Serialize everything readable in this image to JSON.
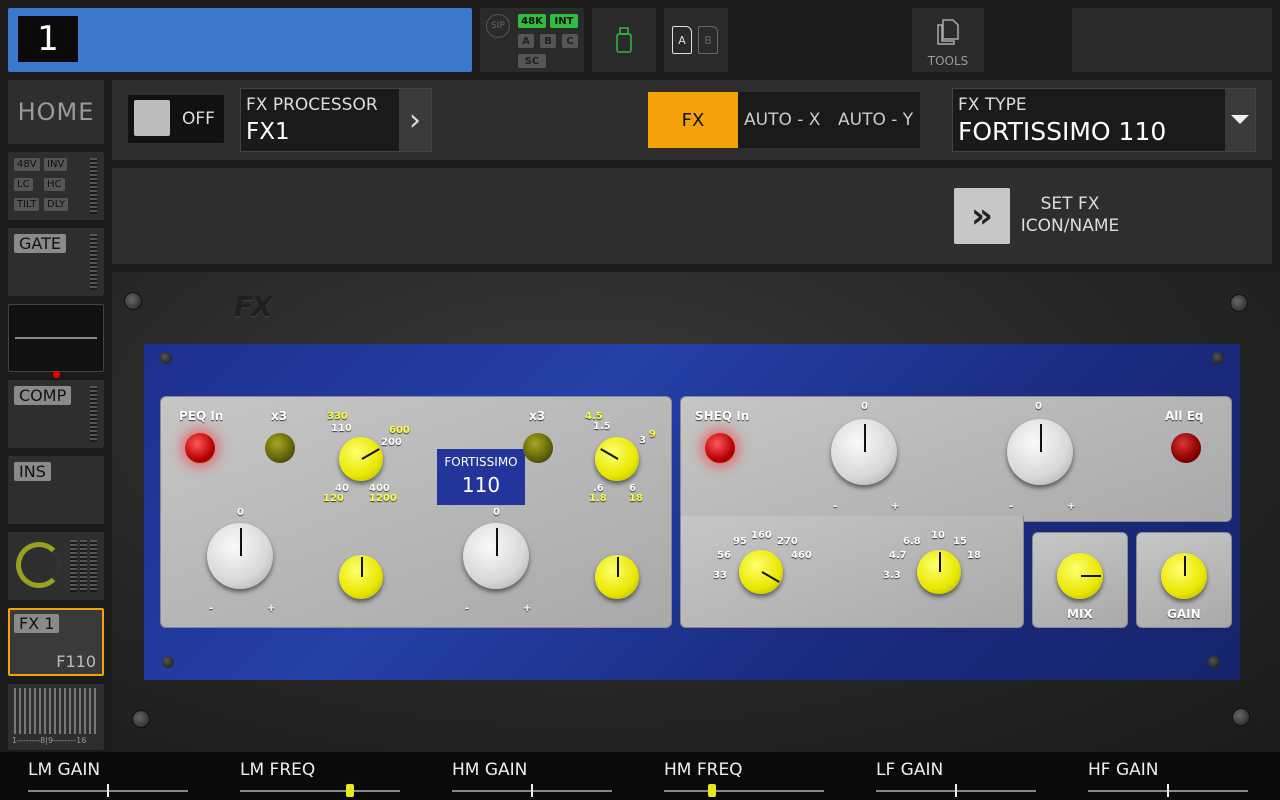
{
  "channel": {
    "number": "1"
  },
  "status": {
    "sip": "SIP",
    "rate": "48K",
    "clock": "INT",
    "buses": [
      "A",
      "B",
      "C"
    ],
    "sc": "SC"
  },
  "cards": {
    "a": "A",
    "b": "B"
  },
  "tools": {
    "label": "TOOLS"
  },
  "sidebar": {
    "home": "HOME",
    "input_tags": [
      "48V",
      "INV",
      "LC",
      "HC",
      "TILT",
      "DLY"
    ],
    "gate": "GATE",
    "comp": "COMP",
    "ins": "INS",
    "fx_label": "FX 1",
    "fx_sub": "F110",
    "meter_scale": "1--------8|9--------16"
  },
  "toolbar": {
    "onoff": "OFF",
    "fx_processor_title": "FX PROCESSOR",
    "fx_processor_value": "FX1",
    "tabs": [
      "FX",
      "AUTO - X",
      "AUTO - Y"
    ],
    "fx_type_title": "FX TYPE",
    "fx_type_value": "FORTISSIMO 110"
  },
  "setfx": {
    "line1": "SET FX",
    "line2": "ICON/NAME"
  },
  "plugin": {
    "brand_line1": "FORTISSIMO",
    "brand_line2": "110",
    "peq_in": "PEQ In",
    "x3_left": "x3",
    "x3_right": "x3",
    "sheq_in": "SHEQ In",
    "all_eq": "All Eq",
    "mix": "MIX",
    "gain": "GAIN",
    "zero": "0",
    "minus": "-",
    "plus": "+",
    "lm_freq_scale": [
      "330",
      "110",
      "600",
      "200",
      "40",
      "120",
      "400",
      "1200"
    ],
    "hm_freq_scale": [
      "4.5",
      "1.5",
      "3",
      "9",
      ".6",
      "1.8",
      "6",
      "18"
    ],
    "lf_freq_scale": [
      "95",
      "160",
      "270",
      "56",
      "460",
      "33"
    ],
    "hf_freq_scale": [
      "6.8",
      "10",
      "15",
      "4.7",
      "18",
      "3.3"
    ]
  },
  "bottom": {
    "params": [
      {
        "label": "LM GAIN",
        "value": 0.5
      },
      {
        "label": "LM FREQ",
        "value": 0.69
      },
      {
        "label": "HM GAIN",
        "value": 0.5
      },
      {
        "label": "HM FREQ",
        "value": 0.3
      },
      {
        "label": "LF GAIN",
        "value": 0.5
      },
      {
        "label": "HF GAIN",
        "value": 0.5
      }
    ]
  },
  "colors": {
    "accent": "#f5a20a",
    "channel": "#3d77cc",
    "status_green": "#2ebd3c",
    "knob_yellow": "#e8e800"
  }
}
